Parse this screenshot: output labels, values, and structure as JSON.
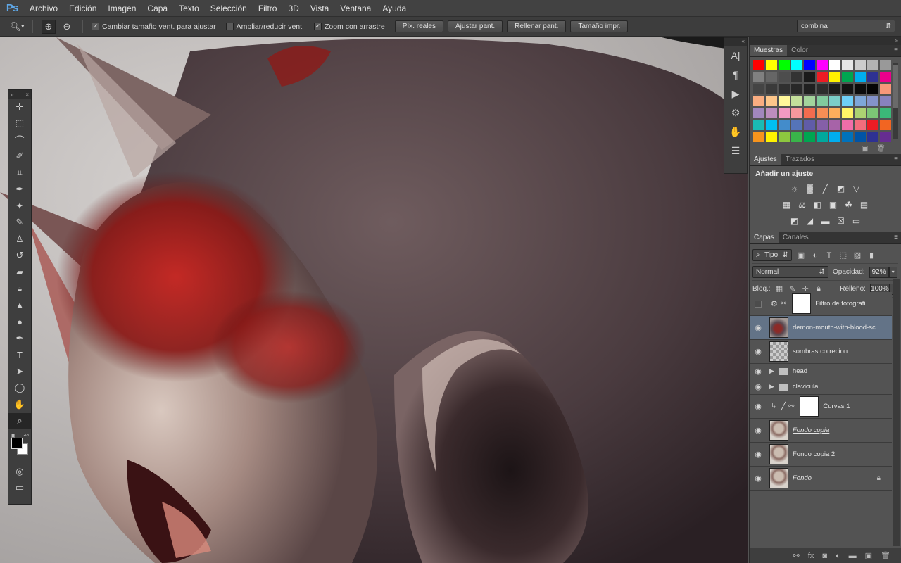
{
  "app": {
    "logo": "Ps"
  },
  "menu": [
    "Archivo",
    "Edición",
    "Imagen",
    "Capa",
    "Texto",
    "Selección",
    "Filtro",
    "3D",
    "Vista",
    "Ventana",
    "Ayuda"
  ],
  "options": {
    "resize_windows": "Cambiar tamaño vent. para ajustar",
    "zoom_all": "Ampliar/reducir vent.",
    "scrubby_zoom": "Zoom con arrastre",
    "actual_pixels": "Píx. reales",
    "fit_screen": "Ajustar pant.",
    "fill_screen": "Rellenar pant.",
    "print_size": "Tamaño impr.",
    "workspace": "combina"
  },
  "panels": {
    "swatches_tab": "Muestras",
    "color_tab": "Color",
    "adjustments_tab": "Ajustes",
    "paths_tab": "Trazados",
    "add_adjustment": "Añadir un ajuste",
    "layers_tab": "Capas",
    "channels_tab": "Canales"
  },
  "swatch_colors": [
    "#ff0000",
    "#ffff00",
    "#00ff00",
    "#00ffff",
    "#0000ff",
    "#ff00ff",
    "#ffffff",
    "#e6e6e6",
    "#cccccc",
    "#b3b3b3",
    "#999999",
    "#808080",
    "#666666",
    "#4d4d4d",
    "#333333",
    "#1a1a1a",
    "#ed1c24",
    "#fff200",
    "#00a651",
    "#00aeef",
    "#2e3192",
    "#ec008c",
    "#444444",
    "#3a3a3a",
    "#303030",
    "#282828",
    "#202020",
    "#2c2c2c",
    "#1c1c1c",
    "#141414",
    "#0c0c0c",
    "#050505",
    "#f7977a",
    "#f9ad81",
    "#fdc68a",
    "#fff79a",
    "#c4df9b",
    "#a3d39c",
    "#82ca9d",
    "#7bcdc8",
    "#6ecff6",
    "#7ea7d8",
    "#8493ca",
    "#8882be",
    "#a187be",
    "#bc8dbf",
    "#f49ac2",
    "#f6989d",
    "#f26c4f",
    "#f68e55",
    "#fbaf5c",
    "#fff467",
    "#acd372",
    "#7cc576",
    "#3bb878",
    "#1abbb4",
    "#00bff3",
    "#438ccb",
    "#5574b9",
    "#605ca8",
    "#855fa8",
    "#a763a8",
    "#f06ea9",
    "#f26d7d",
    "#ed1c24",
    "#f26522",
    "#f7941d",
    "#fff200",
    "#8dc73f",
    "#39b54a",
    "#00a651",
    "#00a99d",
    "#00aeef",
    "#0072bc",
    "#0054a6",
    "#2e3192",
    "#662d91"
  ],
  "layers_controls": {
    "filter_kind": "Tipo",
    "blend_mode": "Normal",
    "opacity_label": "Opacidad:",
    "opacity_value": "92%",
    "lock_label": "Bloq.:",
    "fill_label": "Relleno:",
    "fill_value": "100%"
  },
  "layers": [
    {
      "name": "Filtro de fotografi...",
      "type": "adjustment",
      "visible": false
    },
    {
      "name": "demon-mouth-with-blood-sc...",
      "type": "image",
      "visible": true,
      "selected": true
    },
    {
      "name": "sombras correcion",
      "type": "transparent",
      "visible": true
    },
    {
      "name": "head",
      "type": "group",
      "visible": true
    },
    {
      "name": "clavicula",
      "type": "group",
      "visible": true
    },
    {
      "name": "Curvas 1",
      "type": "curves",
      "visible": true
    },
    {
      "name": "Fondo copia",
      "type": "photo",
      "visible": true
    },
    {
      "name": "Fondo copia 2",
      "type": "photo",
      "visible": true
    },
    {
      "name": "Fondo",
      "type": "photo-locked",
      "visible": true
    }
  ]
}
